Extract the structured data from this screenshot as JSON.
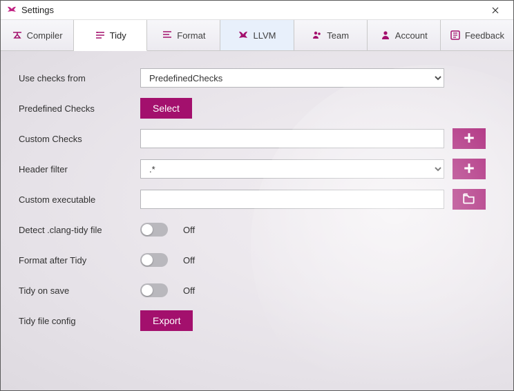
{
  "window": {
    "title": "Settings"
  },
  "tabs": [
    {
      "label": "Compiler",
      "id": "compiler"
    },
    {
      "label": "Tidy",
      "id": "tidy",
      "active": true
    },
    {
      "label": "Format",
      "id": "format"
    },
    {
      "label": "LLVM",
      "id": "llvm",
      "highlight": true
    },
    {
      "label": "Team",
      "id": "team"
    },
    {
      "label": "Account",
      "id": "account"
    },
    {
      "label": "Feedback",
      "id": "feedback"
    }
  ],
  "form": {
    "use_checks_from": {
      "label": "Use checks from",
      "value": "PredefinedChecks"
    },
    "predefined_checks": {
      "label": "Predefined Checks",
      "button": "Select"
    },
    "custom_checks": {
      "label": "Custom Checks",
      "value": "",
      "add_icon": "plus-icon"
    },
    "header_filter": {
      "label": "Header filter",
      "value": ".*",
      "add_icon": "plus-icon"
    },
    "custom_executable": {
      "label": "Custom executable",
      "value": "",
      "open_icon": "folder-open-icon"
    },
    "detect_file": {
      "label": "Detect .clang-tidy file",
      "state": "Off"
    },
    "format_after": {
      "label": "Format after Tidy",
      "state": "Off"
    },
    "tidy_on_save": {
      "label": "Tidy on save",
      "state": "Off"
    },
    "tidy_file_config": {
      "label": "Tidy file config",
      "button": "Export"
    }
  },
  "colors": {
    "accent": "#a3106d"
  }
}
